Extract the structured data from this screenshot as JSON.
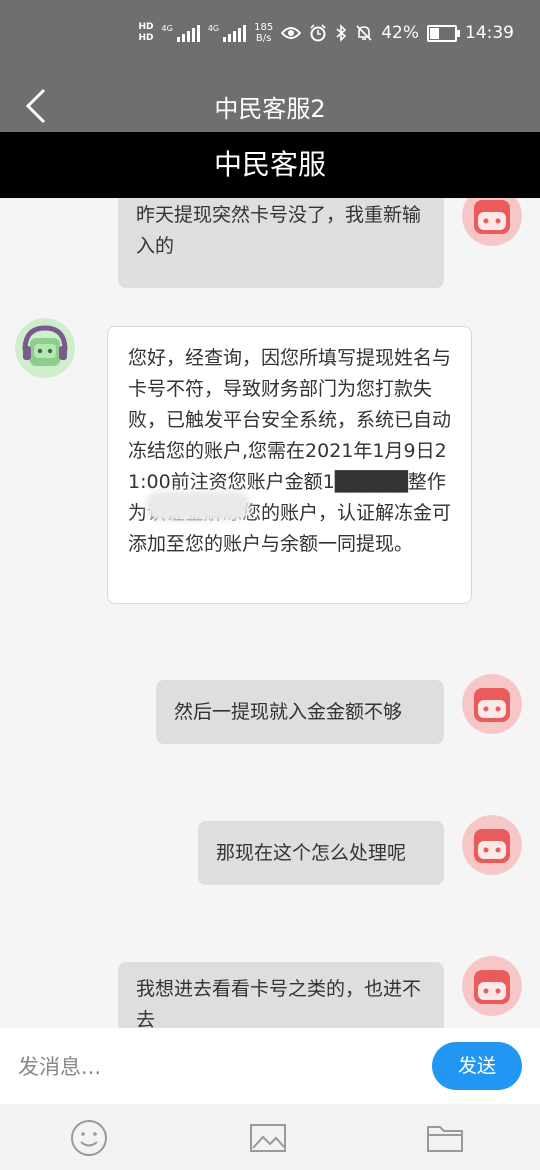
{
  "status": {
    "time": "14:39",
    "battery": "42%",
    "battery_level": 0.42,
    "net_speed_value": "185",
    "net_speed_unit": "B/s",
    "hd1": "HD",
    "hd2": "HD",
    "sig1_label": "4G",
    "sig2_label": "4G"
  },
  "nav": {
    "title": "中民客服2",
    "back_icon": "chevron-left-icon"
  },
  "brand": {
    "title": "中民客服"
  },
  "messages": [
    {
      "side": "me",
      "text": "昨天提现突然卡号没了，我重新输入的"
    },
    {
      "side": "them",
      "text": "您好，经查询，因您所填写提现姓名与卡号不符，导致财务部门为您打款失败，已触发平台安全系统，系统已自动冻结您的账户,您需在2021年1月9日21:00前注资您账户金额1█████整作为认证金解冻您的账户，认证解冻金可添加至您的账户与余额一同提现。"
    },
    {
      "side": "me",
      "text": "然后一提现就入金金额不够"
    },
    {
      "side": "me",
      "text": "那现在这个怎么处理呢"
    },
    {
      "side": "me",
      "text": "我想进去看看卡号之类的，也进不去"
    }
  ],
  "input": {
    "placeholder": "发消息...",
    "value": ""
  },
  "send_label": "发送",
  "toolbar": {
    "icons": [
      "smiley-icon",
      "image-icon",
      "folder-icon"
    ]
  },
  "colors": {
    "bar": "#6f6f6f",
    "brand_bar": "#000000",
    "send": "#2196f3",
    "me_bubble": "#dedede"
  }
}
